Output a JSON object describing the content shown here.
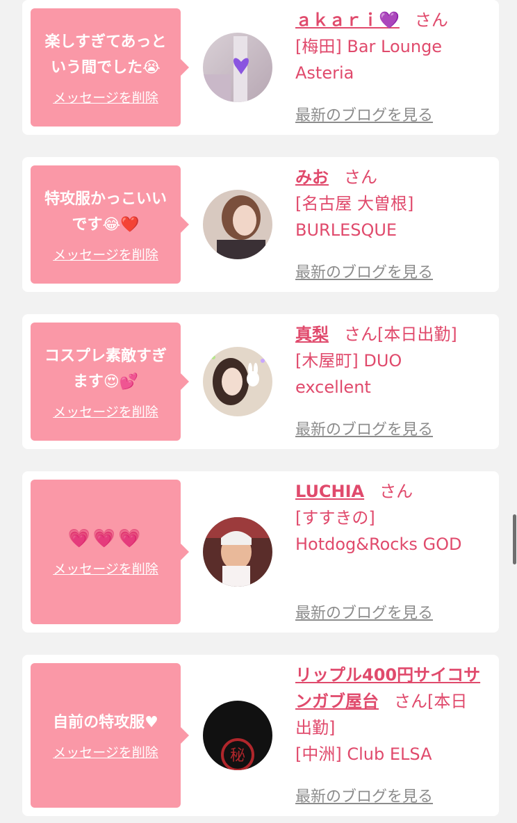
{
  "cards": [
    {
      "message": "楽しすぎてあっという間でした😭",
      "delete_label": "メッセージを削除",
      "name": "ａｋａｒｉ💜",
      "suffix": "さん",
      "shop": "[梅田] Bar Lounge Asteria",
      "blog_label": "最新のブログを見る"
    },
    {
      "message": "特攻服かっこいいです😂❤️",
      "delete_label": "メッセージを削除",
      "name": "みお",
      "suffix": "さん",
      "shop": "[名古屋 大曽根] BURLESQUE",
      "blog_label": "最新のブログを見る"
    },
    {
      "message": "コスプレ素敵すぎます😍💕",
      "delete_label": "メッセージを削除",
      "name": "真梨",
      "suffix": "さん[本日出勤]",
      "shop": "[木屋町] DUO excellent",
      "blog_label": "最新のブログを見る"
    },
    {
      "message": "💗💗💗",
      "delete_label": "メッセージを削除",
      "name": "LUCHIA",
      "suffix": "さん",
      "shop": "[すすきの] Hotdog&Rocks GOD",
      "blog_label": "最新のブログを見る"
    },
    {
      "message": "自前の特攻服♥",
      "delete_label": "メッセージを削除",
      "name": "リップル400円サイコサンガブ屋台",
      "suffix": "さん[本日出勤]",
      "shop": "[中洲] Club ELSA",
      "blog_label": "最新のブログを見る"
    }
  ],
  "colors": {
    "bubble": "#fa98a7",
    "accent": "#e04a6c",
    "link_gray": "#8c8c8c",
    "background": "#f2f2f2"
  }
}
